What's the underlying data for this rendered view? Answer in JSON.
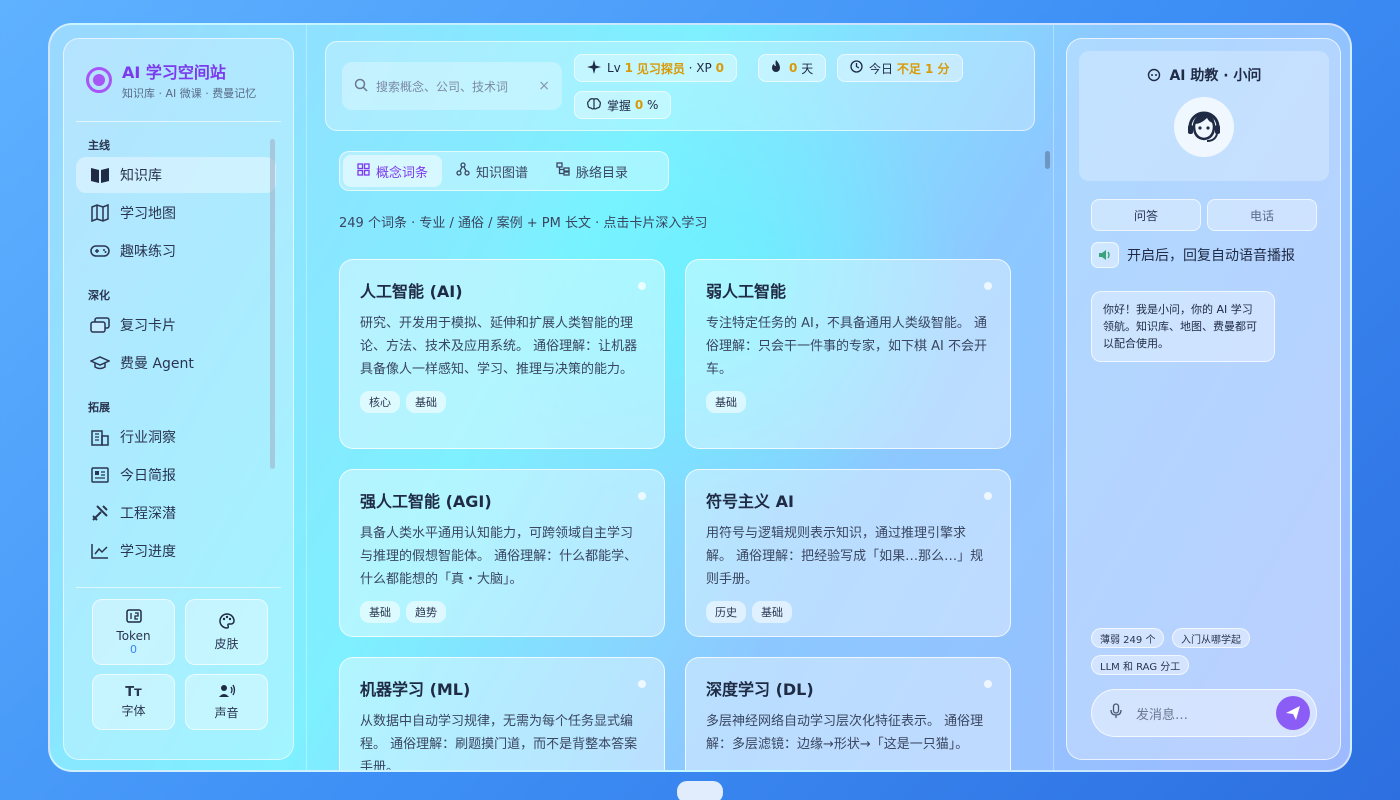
{
  "brand": {
    "title": "AI 学习空间站",
    "subtitle": "知识库 · AI 微课 · 费曼记忆"
  },
  "nav": {
    "groups": [
      {
        "label": "主线",
        "items": [
          {
            "label": "知识库",
            "icon": "book-icon",
            "active": true
          },
          {
            "label": "学习地图",
            "icon": "map-icon"
          },
          {
            "label": "趣味练习",
            "icon": "gamepad-icon"
          }
        ]
      },
      {
        "label": "深化",
        "items": [
          {
            "label": "复习卡片",
            "icon": "cards-icon"
          },
          {
            "label": "费曼 Agent",
            "icon": "graduation-cap-icon"
          }
        ]
      },
      {
        "label": "拓展",
        "items": [
          {
            "label": "行业洞察",
            "icon": "building-icon"
          },
          {
            "label": "今日简报",
            "icon": "newspaper-icon"
          },
          {
            "label": "工程深潜",
            "icon": "tools-icon"
          },
          {
            "label": "学习进度",
            "icon": "trend-icon"
          }
        ]
      }
    ]
  },
  "tools": {
    "token_label": "Token",
    "token_value": "0",
    "skin_label": "皮肤",
    "font_label": "字体",
    "font_icon_text": "Tт",
    "sound_label": "声音"
  },
  "topbar": {
    "search_placeholder": "搜索概念、公司、技术词",
    "search_clear": "×",
    "level_prefix": "Lv",
    "level_value": "1",
    "level_name": "见习探员",
    "xp_label": "· XP",
    "xp_value": "0",
    "streak_value": "0",
    "streak_unit": "天",
    "today_label": "今日",
    "today_value": "不足 1 分",
    "mastery_label": "掌握",
    "mastery_value": "0",
    "mastery_unit": "%"
  },
  "tabs": [
    {
      "label": "概念词条",
      "active": true
    },
    {
      "label": "知识图谱"
    },
    {
      "label": "脉络目录"
    }
  ],
  "summary": "249 个词条 · 专业 / 通俗 / 案例 + PM 长文 · 点击卡片深入学习",
  "cards": [
    {
      "title": "人工智能 (AI)",
      "desc": "研究、开发用于模拟、延伸和扩展人类智能的理论、方法、技术及应用系统。 通俗理解：让机器具备像人一样感知、学习、推理与决策的能力。",
      "tags": [
        "核心",
        "基础"
      ]
    },
    {
      "title": "弱人工智能",
      "desc": "专注特定任务的 AI，不具备通用人类级智能。 通俗理解：只会干一件事的专家，如下棋 AI 不会开车。",
      "tags": [
        "基础"
      ]
    },
    {
      "title": "强人工智能 (AGI)",
      "desc": "具备人类水平通用认知能力，可跨领域自主学习与推理的假想智能体。 通俗理解：什么都能学、什么都能想的「真・大脑」。",
      "tags": [
        "基础",
        "趋势"
      ]
    },
    {
      "title": "符号主义 AI",
      "desc": "用符号与逻辑规则表示知识，通过推理引擎求解。 通俗理解：把经验写成「如果…那么…」规则手册。",
      "tags": [
        "历史",
        "基础"
      ]
    },
    {
      "title": "机器学习 (ML)",
      "desc": "从数据中自动学习规律，无需为每个任务显式编程。 通俗理解：刷题摸门道，而不是背整本答案手册。",
      "tags": []
    },
    {
      "title": "深度学习 (DL)",
      "desc": "多层神经网络自动学习层次化特征表示。 通俗理解：多层滤镜：边缘→形状→「这是一只猫」。",
      "tags": []
    }
  ],
  "assistant": {
    "title": "AI 助教 · 小问",
    "mode_qa": "问答",
    "mode_phone": "电话",
    "voice_text": "开启后，回复自动语音播报",
    "greeting": "你好！我是小问，你的 AI 学习领航。知识库、地图、费曼都可以配合使用。",
    "suggestions": [
      "薄弱 249 个",
      "入门从哪学起",
      "LLM 和 RAG 分工"
    ],
    "composer_placeholder": "发消息…"
  },
  "colors": {
    "accent": "#8b5cf6",
    "brand": "#7c3aed",
    "gold": "#d99a06"
  }
}
